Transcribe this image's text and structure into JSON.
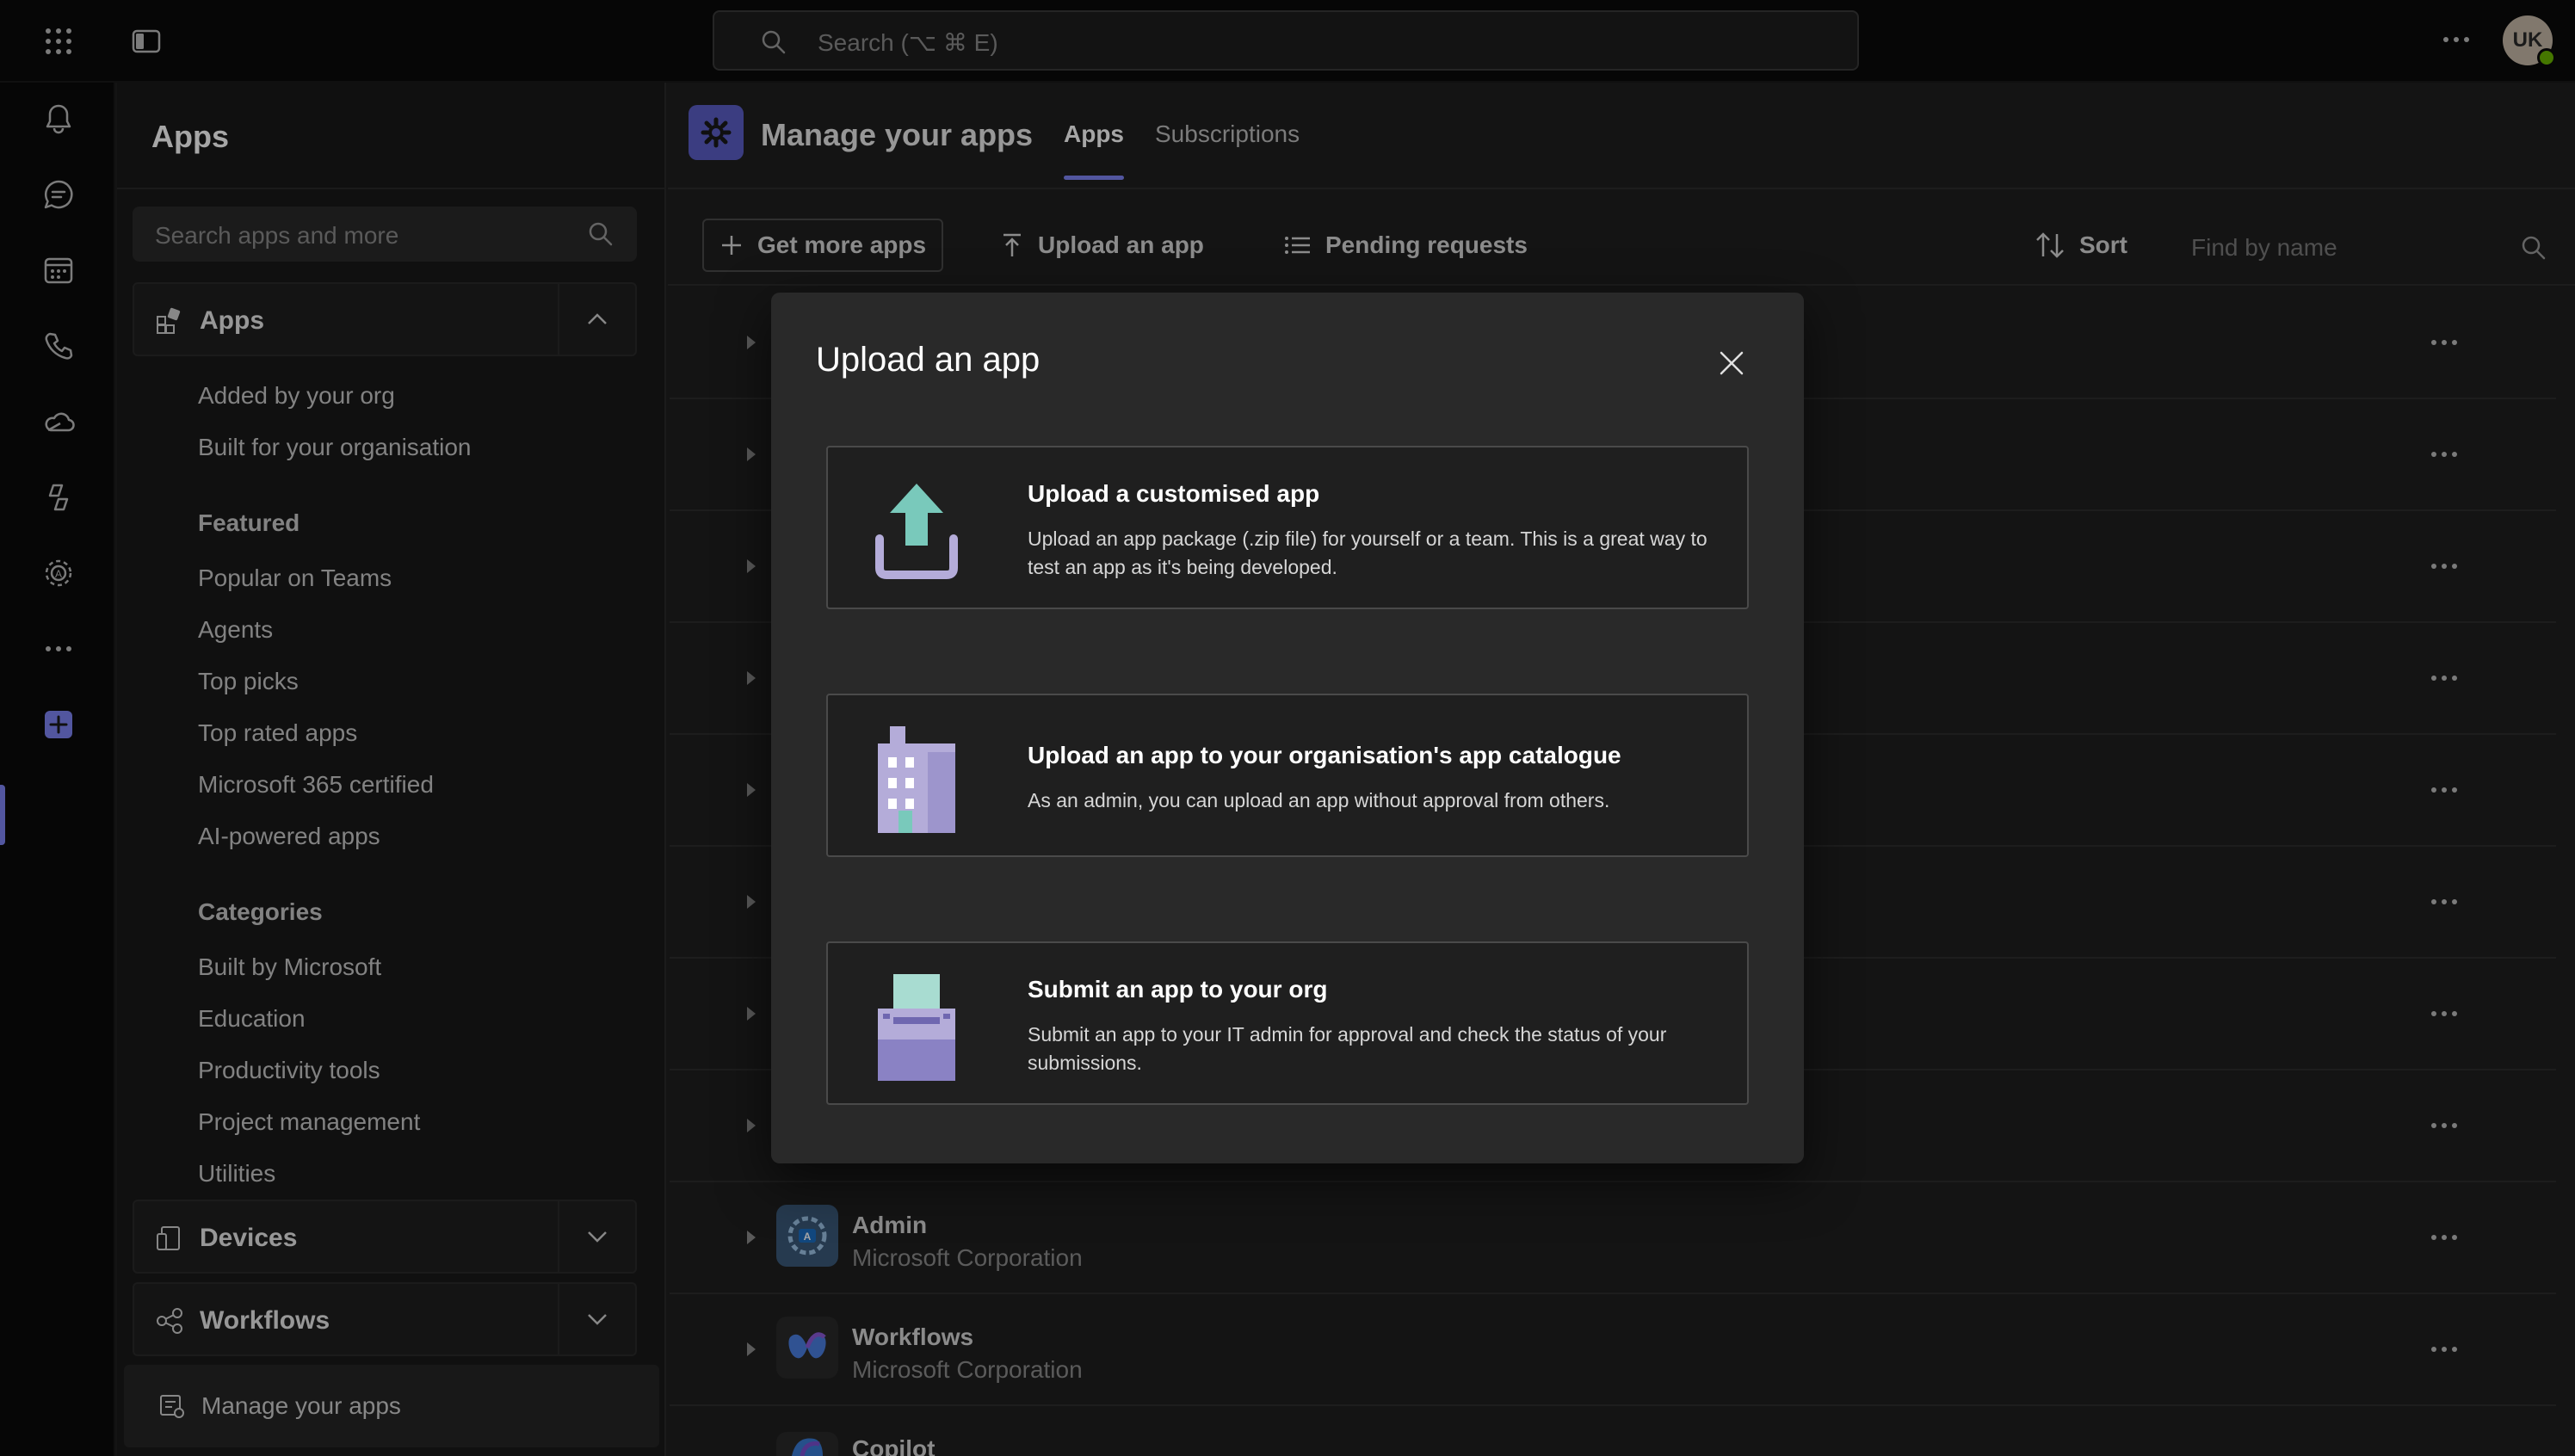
{
  "topbar": {
    "search_placeholder": "Search (⌥ ⌘ E)",
    "avatar_initials": "UK"
  },
  "sidepanel": {
    "title": "Apps",
    "search_placeholder": "Search apps and more",
    "apps_section": {
      "label": "Apps"
    },
    "items": [
      "Added by your org",
      "Built for your organisation"
    ],
    "featured": {
      "heading": "Featured",
      "items": [
        "Popular on Teams",
        "Agents",
        "Top picks",
        "Top rated apps",
        "Microsoft 365 certified",
        "AI-powered apps"
      ]
    },
    "categories": {
      "heading": "Categories",
      "items": [
        "Built by Microsoft",
        "Education",
        "Productivity tools",
        "Project management",
        "Utilities"
      ]
    },
    "devices_section": {
      "label": "Devices"
    },
    "workflows_section": {
      "label": "Workflows"
    },
    "manage_link": "Manage your apps"
  },
  "main": {
    "title": "Manage your apps",
    "tabs": [
      {
        "label": "Apps",
        "active": true
      },
      {
        "label": "Subscriptions",
        "active": false
      }
    ],
    "toolbar": {
      "get_more": "Get more apps",
      "upload": "Upload an app",
      "pending": "Pending requests",
      "sort": "Sort",
      "find_placeholder": "Find by name"
    },
    "rows": [
      {
        "name": "Admin",
        "vendor": "Microsoft Corporation"
      },
      {
        "name": "Workflows",
        "vendor": "Microsoft Corporation"
      },
      {
        "name": "Copilot",
        "vendor": ""
      }
    ]
  },
  "dialog": {
    "title": "Upload an app",
    "options": [
      {
        "title": "Upload a customised app",
        "desc": "Upload an app package (.zip file) for yourself or a team. This is a great way to test an app as it's being developed.",
        "icon": "upload-icon"
      },
      {
        "title": "Upload an app to your organisation's app catalogue",
        "desc": "As an admin, you can upload an app without approval from others.",
        "icon": "building-icon"
      },
      {
        "title": "Submit an app to your org",
        "desc": "Submit an app to your IT admin for approval and check the status of your submissions.",
        "icon": "submit-box-icon"
      }
    ]
  },
  "colors": {
    "accent": "#7f85f5",
    "brand": "#5b5fc7",
    "teal": "#79c9bb",
    "lavender": "#b4acd9"
  }
}
